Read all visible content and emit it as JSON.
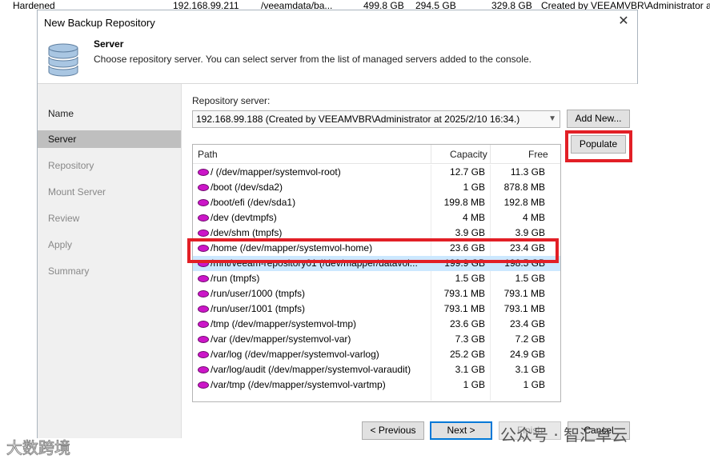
{
  "background_row": {
    "name": "Hardened",
    "ip": "192.168.99.211",
    "path": "/veeamdata/ba...",
    "capacity": "499.8 GB",
    "used": "294.5 GB",
    "free": "329.8 GB",
    "created": "Created by VEEAMVBR\\Administrator a"
  },
  "dialog": {
    "title": "New Backup Repository",
    "close_glyph": "✕",
    "header": {
      "title": "Server",
      "description": "Choose repository server. You can select server from the list of managed servers added to the console.",
      "icon": "database-icon"
    },
    "steps": [
      {
        "label": "Name",
        "state": "done"
      },
      {
        "label": "Server",
        "state": "active"
      },
      {
        "label": "Repository",
        "state": "pending"
      },
      {
        "label": "Mount Server",
        "state": "pending"
      },
      {
        "label": "Review",
        "state": "pending"
      },
      {
        "label": "Apply",
        "state": "pending"
      },
      {
        "label": "Summary",
        "state": "pending"
      }
    ],
    "repository_server_label": "Repository server:",
    "repository_server_value": "192.168.99.188 (Created by VEEAMVBR\\Administrator at 2025/2/10 16:34.)",
    "add_new_label": "Add New...",
    "populate_label": "Populate",
    "table": {
      "columns": [
        "Path",
        "Capacity",
        "Free"
      ],
      "sort_glyph": "^",
      "rows": [
        {
          "path": "/ (/dev/mapper/systemvol-root)",
          "capacity": "12.7 GB",
          "free": "11.3 GB"
        },
        {
          "path": "/boot (/dev/sda2)",
          "capacity": "1 GB",
          "free": "878.8 MB"
        },
        {
          "path": "/boot/efi (/dev/sda1)",
          "capacity": "199.8 MB",
          "free": "192.8 MB"
        },
        {
          "path": "/dev (devtmpfs)",
          "capacity": "4 MB",
          "free": "4 MB"
        },
        {
          "path": "/dev/shm (tmpfs)",
          "capacity": "3.9 GB",
          "free": "3.9 GB"
        },
        {
          "path": "/home (/dev/mapper/systemvol-home)",
          "capacity": "23.6 GB",
          "free": "23.4 GB"
        },
        {
          "path": "/mnt/veeam-repository01 (/dev/mapper/datavol...",
          "capacity": "199.9 GB",
          "free": "198.5 GB",
          "selected": true
        },
        {
          "path": "/run (tmpfs)",
          "capacity": "1.5 GB",
          "free": "1.5 GB"
        },
        {
          "path": "/run/user/1000 (tmpfs)",
          "capacity": "793.1 MB",
          "free": "793.1 MB"
        },
        {
          "path": "/run/user/1001 (tmpfs)",
          "capacity": "793.1 MB",
          "free": "793.1 MB"
        },
        {
          "path": "/tmp (/dev/mapper/systemvol-tmp)",
          "capacity": "23.6 GB",
          "free": "23.4 GB"
        },
        {
          "path": "/var (/dev/mapper/systemvol-var)",
          "capacity": "7.3 GB",
          "free": "7.2 GB"
        },
        {
          "path": "/var/log (/dev/mapper/systemvol-varlog)",
          "capacity": "25.2 GB",
          "free": "24.9 GB"
        },
        {
          "path": "/var/log/audit (/dev/mapper/systemvol-varaudit)",
          "capacity": "3.1 GB",
          "free": "3.1 GB"
        },
        {
          "path": "/var/tmp (/dev/mapper/systemvol-vartmp)",
          "capacity": "1 GB",
          "free": "1 GB"
        }
      ]
    },
    "buttons": {
      "previous": "< Previous",
      "next": "Next >",
      "finish": "Finish",
      "cancel": "Cancel"
    }
  },
  "watermarks": {
    "left": "大数跨境",
    "right": "公众号 · 智汇卓云"
  },
  "colors": {
    "highlight": "#e21f26",
    "selection": "#cce8ff",
    "active_step": "#bfbfbf",
    "disk_icon": "#cc16c8"
  }
}
